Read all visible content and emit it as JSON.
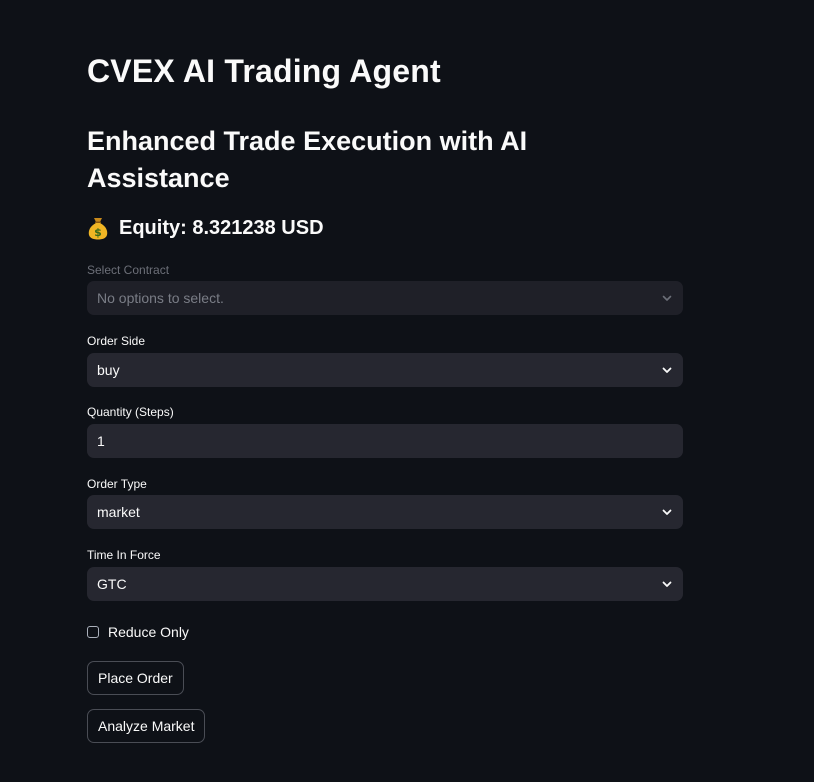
{
  "header": {
    "title": "CVEX AI Trading Agent",
    "subtitle": "Enhanced Trade Execution with AI Assistance",
    "equity_text": "Equity: 8.321238 USD",
    "equity_icon": "money-bag-icon"
  },
  "form": {
    "contract": {
      "label": "Select Contract",
      "placeholder": "No options to select.",
      "disabled": true
    },
    "order_side": {
      "label": "Order Side",
      "value": "buy"
    },
    "quantity": {
      "label": "Quantity (Steps)",
      "value": "1"
    },
    "order_type": {
      "label": "Order Type",
      "value": "market"
    },
    "time_in_force": {
      "label": "Time In Force",
      "value": "GTC"
    },
    "reduce_only": {
      "label": "Reduce Only",
      "checked": false
    }
  },
  "actions": {
    "place_order": "Place Order",
    "analyze_market": "Analyze Market"
  },
  "colors": {
    "background": "#0e1117",
    "input_background": "#262730",
    "text": "#fafafa",
    "muted_text": "#6c6f78"
  }
}
